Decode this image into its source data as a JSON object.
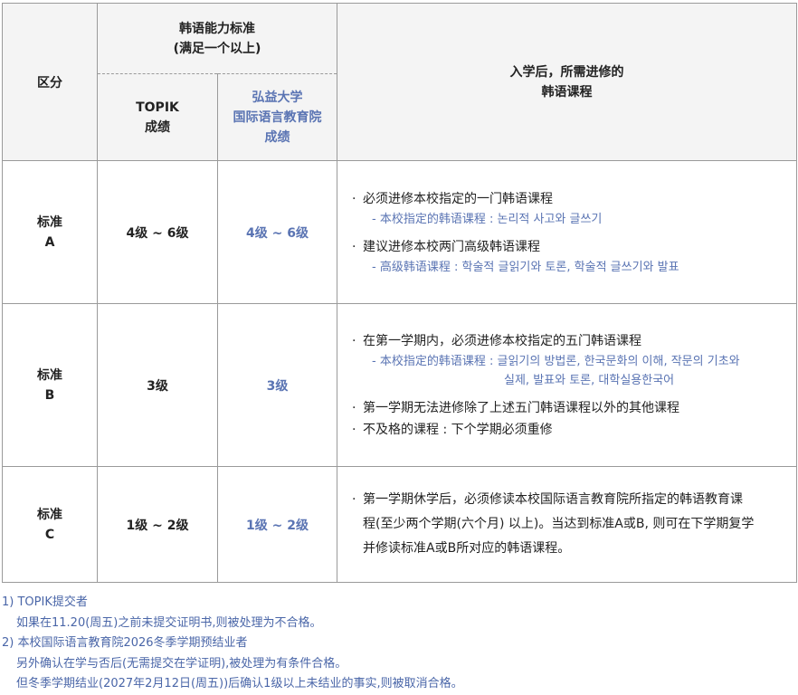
{
  "header": {
    "category": "区分",
    "korean_level": "韩语能力标准",
    "korean_level_sub": "(满足一个以上)",
    "topik_line1": "TOPIK",
    "topik_line2": "成绩",
    "hongik_line1": "弘益大学",
    "hongik_line2": "国际语言教育院",
    "hongik_line3": "成绩",
    "required_line1": "入学后，所需进修的",
    "required_line2": "韩语课程"
  },
  "rows": [
    {
      "label_line1": "标准",
      "label_line2": "A",
      "topik": "4级 ~ 6级",
      "hongik": "4级 ~ 6级",
      "bullet1": "必须进修本校指定的一门韩语课程",
      "sub1": "- 本校指定的韩语课程 : 논리적 사고와 글쓰기",
      "bullet2": "建议进修本校两门高级韩语课程",
      "sub2": "- 高级韩语课程 : 학술적 글읽기와 토론, 학술적 글쓰기와 발표"
    },
    {
      "label_line1": "标准",
      "label_line2": "B",
      "topik": "3级",
      "hongik": "3级",
      "bullet1": "在第一学期内，必须进修本校指定的五门韩语课程",
      "sub1": "- 本校指定的韩语课程 : 글읽기의 방법론, 한국문화의 이해, 작문의 기초와",
      "sub1b": "실제, 발표와 토론, 대학실용한국어",
      "bullet2": "第一学期无法进修除了上述五门韩语课程以外的其他课程",
      "bullet3": "不及格的课程 : 下个学期必须重修"
    },
    {
      "label_line1": "标准",
      "label_line2": "C",
      "topik": "1级 ~ 2级",
      "hongik": "1级 ~ 2级",
      "text_line1": "第一学期休学后，必须修读本校国际语言教育院所指定的韩语教育课",
      "text_line2": "程(至少两个学期(六个月) 以上)。当达到标准A或B, 则可在下学期复学",
      "text_line3": "并修读标准A或B所对应的韩语课程。"
    }
  ],
  "bullet_char": "·",
  "notes": [
    "1) TOPIK提交者",
    "如果在11.20(周五)之前未提交证明书,则被处理为不合格。",
    "2) 本校国际语言教育院2026冬季学期预结业者",
    "另外确认在学与否后(无需提交在学证明),被处理为有条件合格。",
    "但冬季学期结业(2027年2月12日(周五))后确认1级以上未结业的事实,则被取消合格。"
  ]
}
